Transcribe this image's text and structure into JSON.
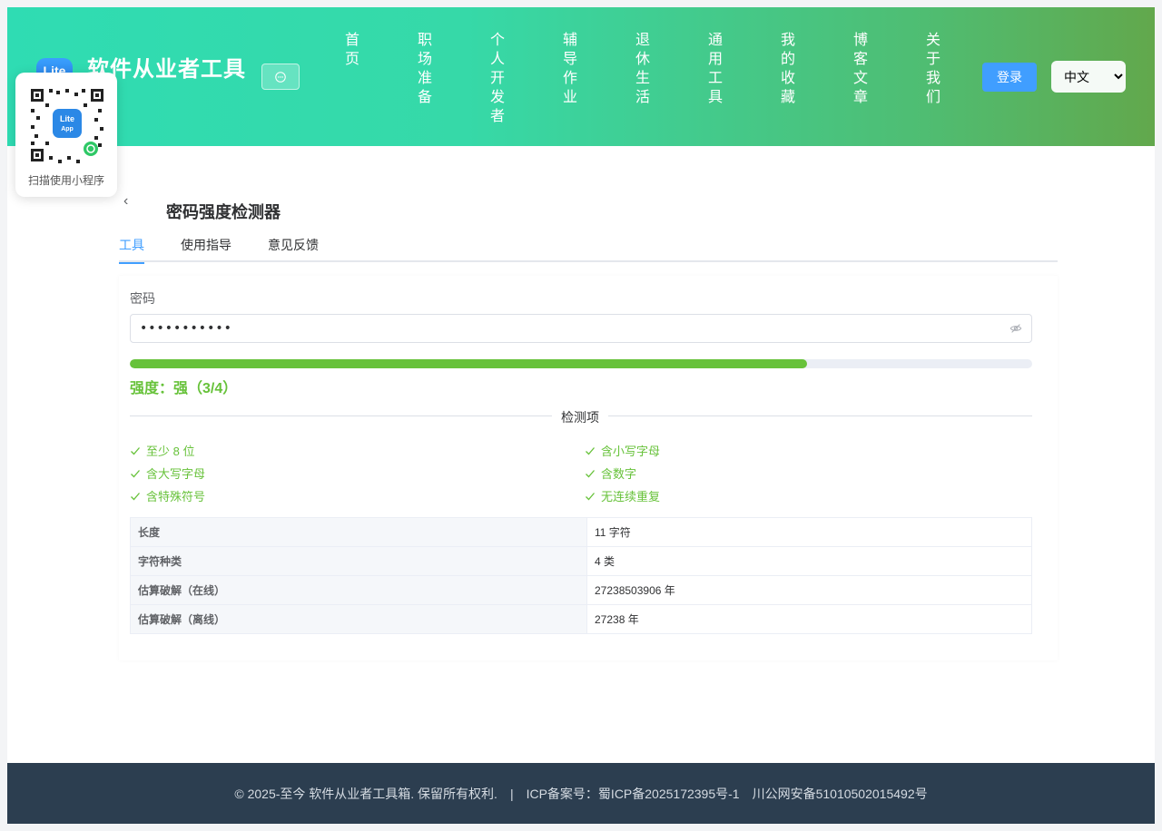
{
  "header": {
    "brand_logo_text": "Lite",
    "brand_title": "软件从业者工具",
    "nav": [
      {
        "label": "首页"
      },
      {
        "label": "职场准备"
      },
      {
        "label": "个人开发者"
      },
      {
        "label": "辅导作业"
      },
      {
        "label": "退休生活"
      },
      {
        "label": "通用工具"
      },
      {
        "label": "我的收藏"
      },
      {
        "label": "博客文章"
      },
      {
        "label": "关于我们"
      }
    ],
    "login_label": "登录",
    "language_selected": "中文"
  },
  "qr_card": {
    "label": "扫描使用小程序",
    "logo_line1": "Lite",
    "logo_line2": "App"
  },
  "page": {
    "title": "密码强度检测器",
    "tabs": [
      {
        "label": "工具",
        "active": true
      },
      {
        "label": "使用指导",
        "active": false
      },
      {
        "label": "意见反馈",
        "active": false
      }
    ]
  },
  "tool": {
    "password_label": "密码",
    "password_value": "•••••••••••",
    "strength_fraction": 0.75,
    "strength_text": "强度：强（3/4）",
    "section_title": "检测项",
    "checks": [
      {
        "label": "至少 8 位",
        "passed": true
      },
      {
        "label": "含小写字母",
        "passed": true
      },
      {
        "label": "含大写字母",
        "passed": true
      },
      {
        "label": "含数字",
        "passed": true
      },
      {
        "label": "含特殊符号",
        "passed": true
      },
      {
        "label": "无连续重复",
        "passed": true
      }
    ],
    "stats": [
      {
        "key": "长度",
        "value": "11 字符"
      },
      {
        "key": "字符种类",
        "value": "4 类"
      },
      {
        "key": "估算破解（在线）",
        "value": "27238503906 年"
      },
      {
        "key": "估算破解（离线）",
        "value": "27238 年"
      }
    ]
  },
  "footer": {
    "copyright": "© 2025-至今 软件从业者工具箱. 保留所有权利.",
    "separator": "|",
    "icp": "ICP备案号：蜀ICP备2025172395号-1",
    "police": "川公网安备51010502015492号"
  },
  "colors": {
    "success": "#67c23a",
    "primary": "#409eff",
    "footer_bg": "#2c3e50"
  }
}
